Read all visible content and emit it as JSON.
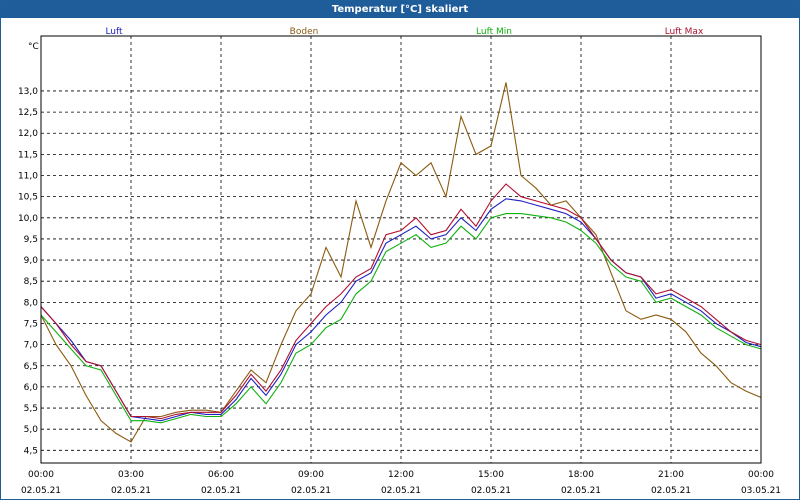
{
  "window": {
    "title": "Temperatur [°C] skaliert"
  },
  "chart_data": {
    "type": "line",
    "unit_label": "°C",
    "ylim": [
      4.2,
      14.3
    ],
    "y_ticks": [
      "4,5",
      "5,0",
      "5,5",
      "6,0",
      "6,5",
      "7,0",
      "7,5",
      "8,0",
      "8,5",
      "9,0",
      "9,5",
      "10,0",
      "10,5",
      "11,0",
      "11,5",
      "12,0",
      "12,5",
      "13,0"
    ],
    "y_tick_values": [
      4.5,
      5.0,
      5.5,
      6.0,
      6.5,
      7.0,
      7.5,
      8.0,
      8.5,
      9.0,
      9.5,
      10.0,
      10.5,
      11.0,
      11.5,
      12.0,
      12.5,
      13.0
    ],
    "x_range_hours": [
      0,
      24
    ],
    "x_ticks": [
      {
        "hour": 0,
        "time": "00:00",
        "date": "02.05.21"
      },
      {
        "hour": 3,
        "time": "03:00",
        "date": "02.05.21"
      },
      {
        "hour": 6,
        "time": "06:00",
        "date": "02.05.21"
      },
      {
        "hour": 9,
        "time": "09:00",
        "date": "02.05.21"
      },
      {
        "hour": 12,
        "time": "12:00",
        "date": "02.05.21"
      },
      {
        "hour": 15,
        "time": "15:00",
        "date": "02.05.21"
      },
      {
        "hour": 18,
        "time": "18:00",
        "date": "02.05.21"
      },
      {
        "hour": 21,
        "time": "21:00",
        "date": "02.05.21"
      },
      {
        "hour": 24,
        "time": "00:00",
        "date": "03.05.21"
      }
    ],
    "grid": true,
    "series": [
      {
        "name": "Luft",
        "color": "#2020c0",
        "x": [
          0,
          0.5,
          1,
          1.5,
          2,
          2.5,
          3,
          3.5,
          4,
          4.5,
          5,
          5.5,
          6,
          6.5,
          7,
          7.5,
          8,
          8.5,
          9,
          9.5,
          10,
          10.5,
          11,
          11.5,
          12,
          12.5,
          13,
          13.5,
          14,
          14.5,
          15,
          15.5,
          16,
          16.5,
          17,
          17.5,
          18,
          18.5,
          19,
          19.5,
          20,
          20.5,
          21,
          21.5,
          22,
          22.5,
          23,
          23.5,
          24
        ],
        "values": [
          7.9,
          7.5,
          7.1,
          6.6,
          6.5,
          5.9,
          5.3,
          5.25,
          5.2,
          5.3,
          5.4,
          5.35,
          5.35,
          5.7,
          6.2,
          5.8,
          6.3,
          7.0,
          7.3,
          7.7,
          8.0,
          8.5,
          8.7,
          9.4,
          9.6,
          9.8,
          9.5,
          9.6,
          10.0,
          9.7,
          10.2,
          10.45,
          10.4,
          10.3,
          10.2,
          10.1,
          9.9,
          9.5,
          9.0,
          8.7,
          8.6,
          8.1,
          8.2,
          8.0,
          7.8,
          7.5,
          7.3,
          7.05,
          6.95
        ]
      },
      {
        "name": "Boden",
        "color": "#8b5a10",
        "x": [
          0,
          0.5,
          1,
          1.5,
          2,
          2.5,
          3,
          3.5,
          4,
          4.5,
          5,
          5.5,
          6,
          6.5,
          7,
          7.5,
          8,
          8.5,
          9,
          9.5,
          10,
          10.5,
          11,
          11.5,
          12,
          12.5,
          13,
          13.5,
          14,
          14.5,
          15,
          15.5,
          16,
          16.5,
          17,
          17.5,
          18,
          18.5,
          19,
          19.5,
          20,
          20.5,
          21,
          21.5,
          22,
          22.5,
          23,
          23.5,
          24
        ],
        "values": [
          7.7,
          7.0,
          6.5,
          5.8,
          5.2,
          4.9,
          4.7,
          5.3,
          5.3,
          5.4,
          5.45,
          5.45,
          5.4,
          5.9,
          6.4,
          6.1,
          7.0,
          7.8,
          8.2,
          9.3,
          8.6,
          10.4,
          9.3,
          10.4,
          11.3,
          11.0,
          11.3,
          10.5,
          12.4,
          11.5,
          11.7,
          13.2,
          11.0,
          10.7,
          10.3,
          10.4,
          10.0,
          9.6,
          8.7,
          7.8,
          7.6,
          7.7,
          7.6,
          7.3,
          6.8,
          6.5,
          6.1,
          5.9,
          5.75
        ]
      },
      {
        "name": "Luft Min",
        "color": "#10b010",
        "x": [
          0,
          0.5,
          1,
          1.5,
          2,
          2.5,
          3,
          3.5,
          4,
          4.5,
          5,
          5.5,
          6,
          6.5,
          7,
          7.5,
          8,
          8.5,
          9,
          9.5,
          10,
          10.5,
          11,
          11.5,
          12,
          12.5,
          13,
          13.5,
          14,
          14.5,
          15,
          15.5,
          16,
          16.5,
          17,
          17.5,
          18,
          18.5,
          19,
          19.5,
          20,
          20.5,
          21,
          21.5,
          22,
          22.5,
          23,
          23.5,
          24
        ],
        "values": [
          7.7,
          7.3,
          6.9,
          6.5,
          6.4,
          5.8,
          5.2,
          5.2,
          5.15,
          5.25,
          5.35,
          5.3,
          5.3,
          5.6,
          6.0,
          5.6,
          6.1,
          6.8,
          7.0,
          7.4,
          7.6,
          8.2,
          8.5,
          9.2,
          9.4,
          9.6,
          9.3,
          9.4,
          9.8,
          9.5,
          10.0,
          10.1,
          10.1,
          10.05,
          10.0,
          9.9,
          9.7,
          9.4,
          8.9,
          8.6,
          8.5,
          8.0,
          8.1,
          7.9,
          7.7,
          7.4,
          7.2,
          7.0,
          6.9
        ]
      },
      {
        "name": "Luft Max",
        "color": "#b01030",
        "x": [
          0,
          0.5,
          1,
          1.5,
          2,
          2.5,
          3,
          3.5,
          4,
          4.5,
          5,
          5.5,
          6,
          6.5,
          7,
          7.5,
          8,
          8.5,
          9,
          9.5,
          10,
          10.5,
          11,
          11.5,
          12,
          12.5,
          13,
          13.5,
          14,
          14.5,
          15,
          15.5,
          16,
          16.5,
          17,
          17.5,
          18,
          18.5,
          19,
          19.5,
          20,
          20.5,
          21,
          21.5,
          22,
          22.5,
          23,
          23.5,
          24
        ],
        "values": [
          7.9,
          7.5,
          7.0,
          6.6,
          6.5,
          5.9,
          5.3,
          5.3,
          5.25,
          5.35,
          5.4,
          5.4,
          5.4,
          5.8,
          6.3,
          5.9,
          6.4,
          7.1,
          7.5,
          7.9,
          8.2,
          8.6,
          8.8,
          9.6,
          9.7,
          10.0,
          9.6,
          9.7,
          10.2,
          9.8,
          10.4,
          10.8,
          10.5,
          10.4,
          10.3,
          10.2,
          10.0,
          9.5,
          9.0,
          8.7,
          8.6,
          8.2,
          8.3,
          8.1,
          7.9,
          7.6,
          7.3,
          7.1,
          7.0
        ]
      }
    ]
  }
}
